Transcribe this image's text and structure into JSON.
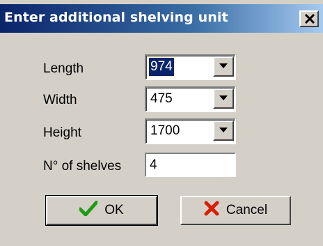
{
  "window": {
    "title": "Enter additional shelving unit",
    "close_icon": "close-icon"
  },
  "fields": {
    "length": {
      "label": "Length",
      "value": "974",
      "selected": true
    },
    "width": {
      "label": "Width",
      "value": "475"
    },
    "height": {
      "label": "Height",
      "value": "1700"
    },
    "shelves": {
      "label": "N° of shelves",
      "value": "4"
    }
  },
  "buttons": {
    "ok": {
      "label": "OK",
      "icon": "checkmark-icon",
      "color": "#1f9b17"
    },
    "cancel": {
      "label": "Cancel",
      "icon": "red-x-icon",
      "color": "#d81e05"
    }
  },
  "colors": {
    "title_bar_start": "#0a246a",
    "title_bar_end": "#a6caf0",
    "dialog_face": "#d4d0c8",
    "selection": "#0a246a"
  }
}
